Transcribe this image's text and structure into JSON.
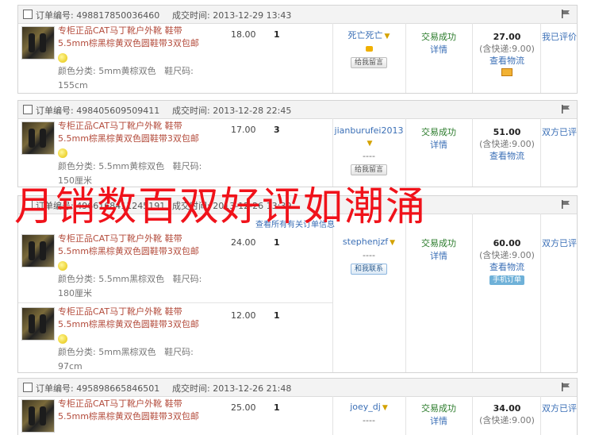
{
  "labels": {
    "order_no": "订单编号:",
    "deal_time": "成交时间:",
    "color_prefix": "颜色分类:",
    "size_prefix": "鞋尺码:",
    "trade_success": "交易成功",
    "details": "详情",
    "shipping_prefix": "(含快递:",
    "shipping_suffix": ")",
    "view_logistics": "查看物流",
    "leave_message": "给我留言",
    "contact_me": "和我联系",
    "mobile_order": "手机订单",
    "dash": "----",
    "review_self": "我已评价",
    "review_both": "双方已评",
    "expand_all": "查看所有有关订单信息"
  },
  "overlay_text": "月销数百双好评如潮涌",
  "orders": [
    {
      "order_no": "498817850036460",
      "time": "2013-12-29 13:43",
      "buyer": "死亡死亡",
      "total": "27.00",
      "shipping": "9.00",
      "review": "我已评价",
      "items": [
        {
          "title": "专柜正品CAT马丁靴户外靴 鞋带5.5mm棕黑棕黄双色圆鞋带3双包邮",
          "color": "5mm黄棕双色",
          "size": "155cm",
          "price": "18.00",
          "qty": "1"
        }
      ]
    },
    {
      "order_no": "498405609509411",
      "time": "2013-12-28 22:45",
      "buyer": "jianburufei2013",
      "total": "51.00",
      "shipping": "9.00",
      "review": "双方已评",
      "items": [
        {
          "title": "专柜正品CAT马丁靴户外靴 鞋带5.5mm棕黑棕黄双色圆鞋带3双包邮",
          "color": "5.5mm黄棕双色",
          "size": "150厘米",
          "price": "17.00",
          "qty": "3"
        }
      ]
    },
    {
      "order_no": "4966168411245191",
      "time": "2013-12-26 13:39",
      "buyer": "stephenjzf",
      "total": "60.00",
      "shipping": "9.00",
      "review": "双方已评",
      "items": [
        {
          "title": "专柜正品CAT马丁靴户外靴 鞋带5.5mm棕黑棕黄双色圆鞋带3双包邮",
          "color": "5.5mm黑棕双色",
          "size": "180厘米",
          "price": "24.00",
          "qty": "1"
        },
        {
          "title": "专柜正品CAT马丁靴户外靴 鞋带5.5mm棕黑棕黄双色圆鞋带3双包邮",
          "color": "5mm黑棕双色",
          "size": "97cm",
          "price": "12.00",
          "qty": "1"
        }
      ]
    },
    {
      "order_no": "495898665846501",
      "time": "2013-12-26 21:48",
      "buyer": "joey_dj",
      "total": "34.00",
      "shipping": "9.00",
      "review": "双方已评",
      "items": [
        {
          "title": "专柜正品CAT马丁靴户外靴 鞋带5.5mm棕黑棕黄双色圆鞋带3双包邮",
          "color": "",
          "size": "",
          "price": "25.00",
          "qty": "1"
        }
      ]
    }
  ]
}
